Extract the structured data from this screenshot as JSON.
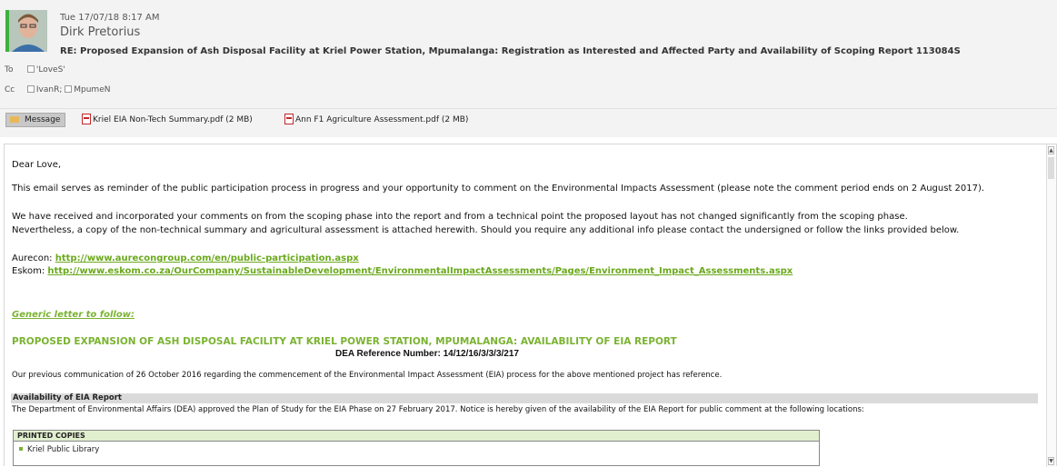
{
  "header": {
    "date": "Tue 17/07/18 8:17 AM",
    "sender": "Dirk Pretorius",
    "subject": "RE: Proposed Expansion of Ash Disposal Facility at Kriel Power Station, Mpumalanga: Registration as Interested and Affected Party and Availability of Scoping Report 113084S",
    "to_label": "To",
    "to": [
      "'LoveS'"
    ],
    "cc_label": "Cc",
    "cc": [
      "IvanR;",
      "MpumeN"
    ]
  },
  "attachments": {
    "message_tab": "Message",
    "items": [
      "Kriel EIA Non-Tech Summary.pdf (2 MB)",
      "Ann F1 Agriculture Assessment.pdf (2 MB)"
    ]
  },
  "body": {
    "greeting": "Dear Love,",
    "para1": "This email serves as reminder of the public participation process in progress and your opportunity to comment on the Environmental Impacts Assessment (please note the comment period ends on 2 August 2017).",
    "para2_line1": "We have received and incorporated your comments on from the scoping phase into the report and from a technical point the proposed layout has not changed significantly from the scoping phase.",
    "para2_line2": "Nevertheless, a copy of the non-technical summary and agricultural assessment is attached herewith. Should you require any additional info please contact the undersigned or follow the links provided below.",
    "aurecon_label": "Aurecon: ",
    "aurecon_link": "http://www.aurecongroup.com/en/public-participation.aspx",
    "eskom_label": "Eskom: ",
    "eskom_link": "http://www.eskom.co.za/OurCompany/SustainableDevelopment/EnvironmentalImpactAssessments/Pages/Environment_Impact_Assessments.aspx",
    "generic_heading": "Generic letter to follow:",
    "letter_title": "PROPOSED EXPANSION OF ASH DISPOSAL FACILITY AT KRIEL POWER STATION, MPUMALANGA: AVAILABILITY OF EIA REPORT",
    "dea_ref": "DEA Reference Number: 14/12/16/3/3/3/217",
    "previous_comm": "Our previous communication of 26 October 2016 regarding the commencement of the Environmental Impact Assessment (EIA) process for the above mentioned project has reference.",
    "availability_heading": "Availability of EIA Report",
    "availability_text": "The Department of Environmental Affairs (DEA) approved the Plan of Study for the EIA Phase on 27 February 2017. Notice is hereby given of the availability of the EIA Report for public comment at the following locations:",
    "table_header": "PRINTED COPIES",
    "table_rows": [
      "Kriel Public Library"
    ]
  },
  "colors": {
    "accent_green": "#7ab331",
    "link_green": "#6aa91c",
    "pdf_red": "#c0262b"
  },
  "icons": [
    "avatar-photo",
    "envelope-icon",
    "pdf-icon",
    "checkbox-icon",
    "scroll-up-arrow-icon",
    "scroll-down-arrow-icon"
  ]
}
